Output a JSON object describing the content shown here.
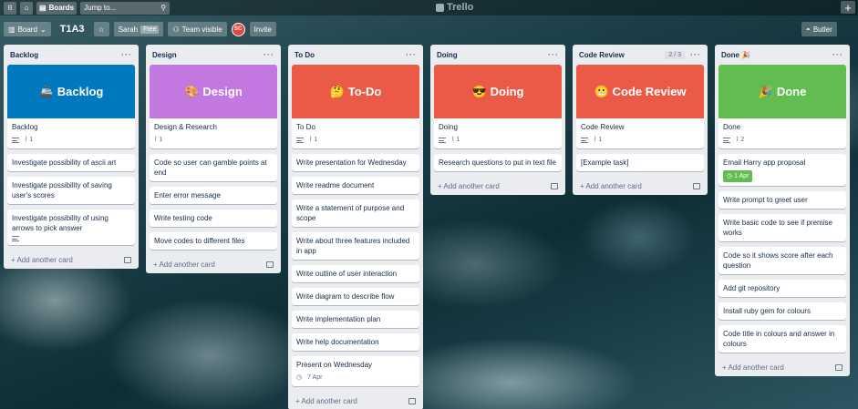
{
  "header": {
    "boards_label": "Boards",
    "search_placeholder": "Jump to...",
    "logo": "Trello"
  },
  "boardbar": {
    "board_view": "Board",
    "title": "T1A3",
    "workspace": "Sarah",
    "plan_badge": "Free",
    "visibility": "Team visible",
    "avatar_initials": "SC",
    "invite_label": "Invite",
    "butler_label": "Butler"
  },
  "lists": [
    {
      "title": "Backlog",
      "cover": {
        "label": "Backlog",
        "emoji": "🚢",
        "color": "#0079bf"
      },
      "cover_card": {
        "title": "Backlog",
        "attachments": "1"
      },
      "cards": [
        {
          "title": "Investigate possibility of ascii art"
        },
        {
          "title": "Investigate possibility of saving user's scores"
        },
        {
          "title": "Investigate possibility of using arrows to pick answer",
          "has_desc": true
        }
      ],
      "add_card": "Add another card"
    },
    {
      "title": "Design",
      "cover": {
        "label": "Design",
        "emoji": "🎨",
        "color": "#c377e0"
      },
      "cover_card": {
        "title": "Design & Research",
        "attachments": "1"
      },
      "cards": [
        {
          "title": "Code so user can gamble points at end"
        },
        {
          "title": "Enter error message"
        },
        {
          "title": "Write testing code"
        },
        {
          "title": "Move codes to different files"
        }
      ],
      "add_card": "Add another card"
    },
    {
      "title": "To Do",
      "cover": {
        "label": "To-Do",
        "emoji": "🤔",
        "color": "#eb5a46"
      },
      "cover_card": {
        "title": "To Do",
        "attachments": "1"
      },
      "cards": [
        {
          "title": "Write presentation for Wednesday"
        },
        {
          "title": "Write readme document"
        },
        {
          "title": "Write a statement of purpose and scope"
        },
        {
          "title": "Write about three features included in app"
        },
        {
          "title": "Write outline of user interaction"
        },
        {
          "title": "Write diagram to describe flow"
        },
        {
          "title": "Write implementation plan"
        },
        {
          "title": "Write help documentation"
        },
        {
          "title": "Present on Wednesday",
          "date": "7 Apr"
        }
      ],
      "add_card": "Add another card"
    },
    {
      "title": "Doing",
      "cover": {
        "label": "Doing",
        "emoji": "😎",
        "color": "#eb5a46"
      },
      "cover_card": {
        "title": "Doing",
        "attachments": "1"
      },
      "cards": [
        {
          "title": "Research questions to put in text file"
        }
      ],
      "add_card": "Add another card"
    },
    {
      "title": "Code Review",
      "count": "2 / 3",
      "cover": {
        "label": "Code Review",
        "emoji": "😬",
        "color": "#eb5a46"
      },
      "cover_card": {
        "title": "Code Review",
        "attachments": "1"
      },
      "cards": [
        {
          "title": "[Example task]"
        }
      ],
      "add_card": "Add another card"
    },
    {
      "title": "Done 🎉",
      "cover": {
        "label": "Done",
        "emoji": "🎉",
        "color": "#61bd4f"
      },
      "cover_card": {
        "title": "Done",
        "attachments": "2"
      },
      "cards": [
        {
          "title": "Email Harry app proposal",
          "due": "1 Apr"
        },
        {
          "title": "Write prompt to greet user"
        },
        {
          "title": "Write basic code to see if premise works"
        },
        {
          "title": "Code so it shows score after each question"
        },
        {
          "title": "Add git repository"
        },
        {
          "title": "Install ruby gem for colours"
        },
        {
          "title": "Code title in colours and answer in colours"
        }
      ],
      "add_card": "Add another card"
    }
  ]
}
